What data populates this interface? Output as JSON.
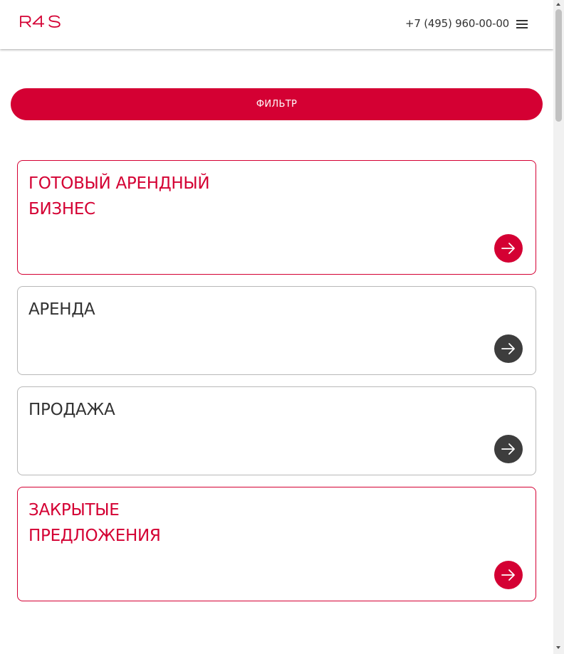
{
  "header": {
    "logo_text": "R4S",
    "phone": "+7 (495) 960-00-00",
    "menu_icon": "hamburger-menu-icon"
  },
  "filter": {
    "label": "ФИЛЬТР"
  },
  "cards": [
    {
      "title_line1": "ГОТОВЫЙ АРЕНДНЫЙ",
      "title_line2": "БИЗНЕС",
      "accent": true,
      "icon": "arrow-right-icon"
    },
    {
      "title_line1": "АРЕНДА",
      "title_line2": "",
      "accent": false,
      "icon": "arrow-right-icon"
    },
    {
      "title_line1": "ПРОДАЖА",
      "title_line2": "",
      "accent": false,
      "icon": "arrow-right-icon"
    },
    {
      "title_line1": "ЗАКРЫТЫЕ",
      "title_line2": "ПРЕДЛОЖЕНИЯ",
      "accent": true,
      "icon": "arrow-right-icon"
    }
  ],
  "colors": {
    "brand_red": "#d40033",
    "dark_text": "#333333",
    "dark_button": "#3d3d3d",
    "card_border": "#b8b8b8"
  }
}
